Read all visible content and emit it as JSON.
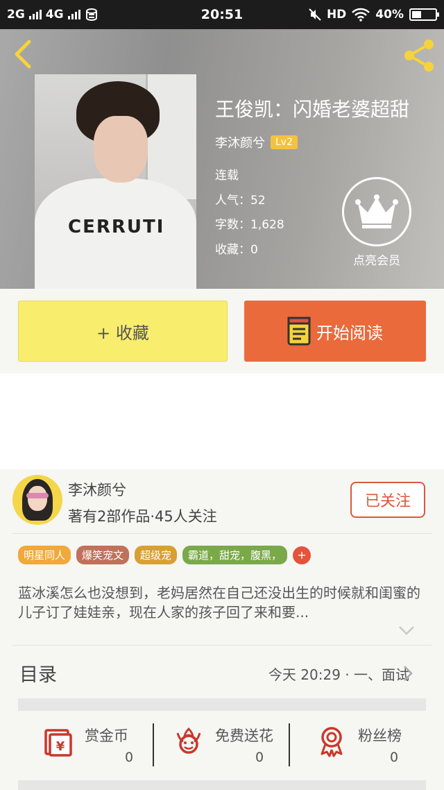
{
  "status_bar": {
    "network1": "2G",
    "network2": "4G",
    "time": "20:51",
    "hd": "HD",
    "battery": "40%",
    "battery_level": 0.4
  },
  "book": {
    "title": "王俊凯：闪婚老婆超甜",
    "author": "李沐颜兮",
    "level": "Lv2",
    "status": "连载",
    "popularity": "人气：52",
    "word_count": "字数：1,628",
    "favorites": "收藏：0",
    "cover_text": "CERRUTI"
  },
  "vip": {
    "label": "点亮会员"
  },
  "actions": {
    "collect_label": "+ 收藏",
    "read_label": "开始阅读"
  },
  "author_card": {
    "name": "李沐颜兮",
    "stats": "著有2部作品·45人关注",
    "follow_label": "已关注"
  },
  "tags": [
    {
      "label": "明星同人",
      "color": "#f0a93a"
    },
    {
      "label": "爆笑宠文",
      "color": "#c0715a"
    },
    {
      "label": "超级宠",
      "color": "#d8a032"
    },
    {
      "label": "霸道，甜宠，腹黑，",
      "color": "#7aa94a"
    }
  ],
  "tags_more": "+",
  "intro": "蓝冰溪怎么也没想到，老妈居然在自己还没出生的时候就和闺蜜的儿子订了娃娃亲，现在人家的孩子回了来和要...",
  "catalog": {
    "title": "目录",
    "latest": "今天 20:29 · 一、面试"
  },
  "bottom_stats": [
    {
      "label": "赏金币",
      "value": "0",
      "icon": "reward-coin-icon"
    },
    {
      "label": "免费送花",
      "value": "0",
      "icon": "flower-icon"
    },
    {
      "label": "粉丝榜",
      "value": "0",
      "icon": "medal-icon"
    }
  ],
  "colors": {
    "accent_orange": "#ea6a3b",
    "collect_yellow": "#f9ed6e",
    "follow_red": "#d9593a",
    "level_badge": "#f5c23c"
  }
}
